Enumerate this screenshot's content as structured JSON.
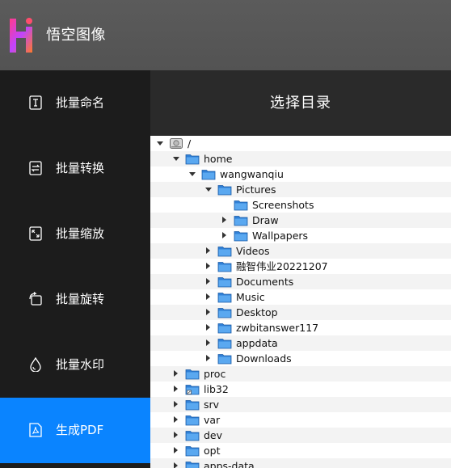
{
  "app": {
    "title": "悟空图像"
  },
  "sidebar": {
    "items": [
      {
        "label": "批量命名",
        "icon": "rename-icon",
        "active": false
      },
      {
        "label": "批量转换",
        "icon": "convert-icon",
        "active": false
      },
      {
        "label": "批量缩放",
        "icon": "resize-icon",
        "active": false
      },
      {
        "label": "批量旋转",
        "icon": "rotate-icon",
        "active": false
      },
      {
        "label": "批量水印",
        "icon": "watermark-icon",
        "active": false
      },
      {
        "label": "生成PDF",
        "icon": "pdf-icon",
        "active": true
      }
    ]
  },
  "panel": {
    "title": "选择目录"
  },
  "tree": {
    "rows": [
      {
        "name": "/",
        "depth": 0,
        "state": "expanded",
        "icon": "drive-icon"
      },
      {
        "name": "home",
        "depth": 1,
        "state": "expanded",
        "icon": "folder-icon"
      },
      {
        "name": "wangwanqiu",
        "depth": 2,
        "state": "expanded",
        "icon": "folder-icon"
      },
      {
        "name": "Pictures",
        "depth": 3,
        "state": "expanded",
        "icon": "folder-icon"
      },
      {
        "name": "Screenshots",
        "depth": 4,
        "state": "leaf",
        "icon": "folder-icon"
      },
      {
        "name": "Draw",
        "depth": 4,
        "state": "collapsed",
        "icon": "folder-icon"
      },
      {
        "name": "Wallpapers",
        "depth": 4,
        "state": "collapsed",
        "icon": "folder-icon"
      },
      {
        "name": "Videos",
        "depth": 3,
        "state": "collapsed",
        "icon": "folder-icon"
      },
      {
        "name": "融智伟业20221207",
        "depth": 3,
        "state": "collapsed",
        "icon": "folder-icon"
      },
      {
        "name": "Documents",
        "depth": 3,
        "state": "collapsed",
        "icon": "folder-icon"
      },
      {
        "name": "Music",
        "depth": 3,
        "state": "collapsed",
        "icon": "folder-icon"
      },
      {
        "name": "Desktop",
        "depth": 3,
        "state": "collapsed",
        "icon": "folder-icon"
      },
      {
        "name": "zwbitanswer117",
        "depth": 3,
        "state": "collapsed",
        "icon": "folder-icon"
      },
      {
        "name": "appdata",
        "depth": 3,
        "state": "collapsed",
        "icon": "folder-icon"
      },
      {
        "name": "Downloads",
        "depth": 3,
        "state": "collapsed",
        "icon": "folder-icon"
      },
      {
        "name": "proc",
        "depth": 1,
        "state": "collapsed",
        "icon": "folder-icon"
      },
      {
        "name": "lib32",
        "depth": 1,
        "state": "collapsed",
        "icon": "folder-link-icon"
      },
      {
        "name": "srv",
        "depth": 1,
        "state": "collapsed",
        "icon": "folder-icon"
      },
      {
        "name": "var",
        "depth": 1,
        "state": "collapsed",
        "icon": "folder-icon"
      },
      {
        "name": "dev",
        "depth": 1,
        "state": "collapsed",
        "icon": "folder-icon"
      },
      {
        "name": "opt",
        "depth": 1,
        "state": "collapsed",
        "icon": "folder-icon"
      },
      {
        "name": "apps-data",
        "depth": 1,
        "state": "collapsed",
        "icon": "folder-icon"
      }
    ]
  },
  "colors": {
    "accent": "#0a84ff",
    "sidebar_bg": "#1c1c1c",
    "header_bg": "#5b5b5b",
    "folder_blue": "#3d8ee0"
  }
}
